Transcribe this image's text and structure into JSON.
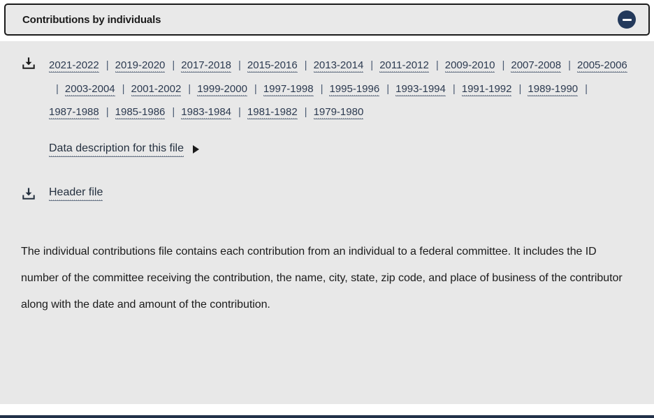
{
  "accordion": {
    "title": "Contributions by individuals",
    "collapse_icon": "minus-circle-icon",
    "collapse_color": "#23395b",
    "expanded": true
  },
  "downloads": {
    "icon": "download-icon",
    "years": [
      "2021-2022",
      "2019-2020",
      "2017-2018",
      "2015-2016",
      "2013-2014",
      "2011-2012",
      "2009-2010",
      "2007-2008",
      "2005-2006",
      "2003-2004",
      "2001-2002",
      "1999-2000",
      "1997-1998",
      "1995-1996",
      "1993-1994",
      "1991-1992",
      "1989-1990",
      "1987-1988",
      "1985-1986",
      "1983-1984",
      "1981-1982",
      "1979-1980"
    ],
    "separator": "|"
  },
  "data_description": {
    "label": "Data description for this file",
    "toggle_icon": "triangle-right-icon"
  },
  "header_file": {
    "label": "Header file",
    "icon": "download-icon"
  },
  "description": {
    "text": "The individual contributions file contains each contribution from an individual to a federal committee. It includes the ID number of the committee receiving the contribution, the name, city, state, zip code, and place of business of the contributor along with the date and amount of the contribution."
  },
  "colors": {
    "link": "#2c3a50",
    "panel_bg": "#e8e8e8",
    "rule": "#223149"
  }
}
